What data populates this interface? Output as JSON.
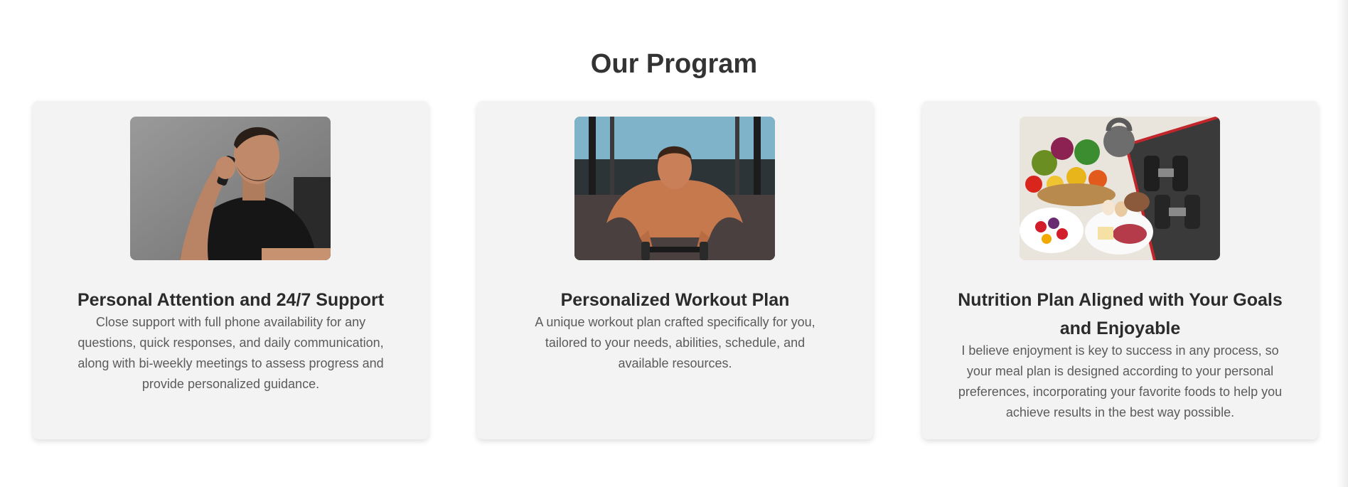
{
  "section": {
    "title": "Our Program"
  },
  "cards": [
    {
      "title": "Personal Attention and 24/7 Support",
      "description": "Close support with full phone availability for any questions, quick responses, and daily communication, along with bi-weekly meetings to assess progress and provide personalized guidance.",
      "image": "man-on-phone-photo"
    },
    {
      "title": "Personalized Workout Plan",
      "description": "A unique workout plan crafted specifically for you, tailored to your needs, abilities, schedule, and available resources.",
      "image": "man-doing-pushups-photo"
    },
    {
      "title": "Nutrition Plan Aligned with Your Goals and Enjoyable",
      "description": "I believe enjoyment is key to success in any process, so your meal plan is designed according to your personal preferences, incorporating your favorite foods to help you achieve results in the best way possible.",
      "image": "healthy-food-and-dumbbells-photo"
    }
  ],
  "colors": {
    "card_background": "#f3f3f3",
    "title_text": "#333333",
    "body_text": "#5b5b5b"
  }
}
